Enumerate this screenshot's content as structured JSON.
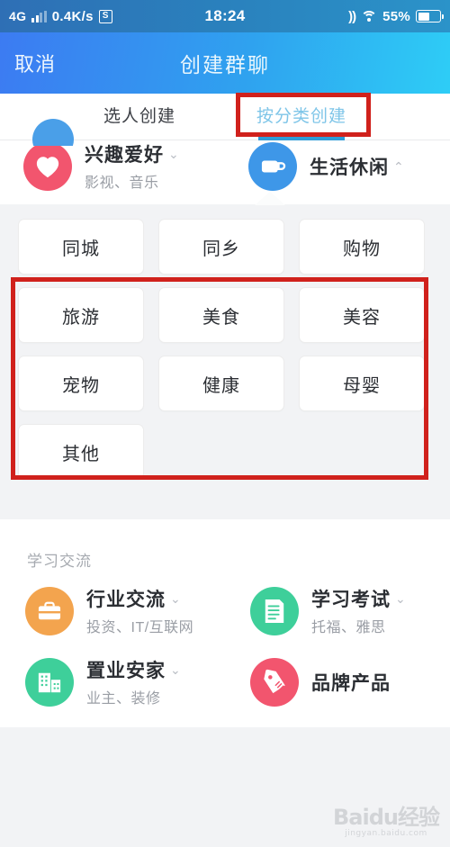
{
  "status_bar": {
    "network": "4G",
    "speed": "0.4K/s",
    "badge": "S",
    "time": "18:24",
    "vibrate_icon": "vibrate-icon",
    "wifi_icon": "wifi-icon",
    "battery_percent": "55%",
    "battery_level": 55
  },
  "nav": {
    "cancel_label": "取消",
    "title": "创建群聊"
  },
  "tabs": [
    {
      "label": "选人创建",
      "active": false
    },
    {
      "label": "按分类创建",
      "active": true
    }
  ],
  "categories": [
    {
      "title": "兴趣爱好",
      "subtitle": "影视、音乐",
      "icon": "heart-icon",
      "icon_color": "#f2556e",
      "chevron": "chevron-down-icon",
      "chevron_glyph": "⌄",
      "expanded": false
    },
    {
      "title": "生活休闲",
      "subtitle": "",
      "icon": "coffee-cup-icon",
      "icon_color": "#3e97e8",
      "chevron": "chevron-up-icon",
      "chevron_glyph": "⌃",
      "expanded": true
    }
  ],
  "grid": {
    "items": [
      "同城",
      "同乡",
      "购物",
      "旅游",
      "美食",
      "美容",
      "宠物",
      "健康",
      "母婴",
      "其他"
    ]
  },
  "section": {
    "title": "学习交流",
    "items": [
      {
        "title": "行业交流",
        "subtitle": "投资、IT/互联网",
        "icon": "briefcase-icon",
        "icon_color": "#f3a44e",
        "chevron_glyph": "⌄"
      },
      {
        "title": "学习考试",
        "subtitle": "托福、雅思",
        "icon": "document-icon",
        "icon_color": "#3ecf9a",
        "chevron_glyph": "⌄"
      },
      {
        "title": "置业安家",
        "subtitle": "业主、装修",
        "icon": "building-icon",
        "icon_color": "#3ecf9a",
        "chevron_glyph": "⌄"
      },
      {
        "title": "品牌产品",
        "subtitle": "",
        "icon": "price-tag-icon",
        "icon_color": "#f2556e",
        "chevron_glyph": ""
      }
    ]
  },
  "annotations": {
    "tab_highlight_color": "#d0211c",
    "grid_highlight_color": "#d0211c"
  },
  "watermark": {
    "main": "Baidu经验",
    "sub": "jingyan.baidu.com"
  },
  "theme": {
    "nav_gradient_start": "#3c7bf2",
    "nav_gradient_end": "#2ecdf6",
    "tab_active_color": "#7ec5e8",
    "tab_underline_color": "#2d9cd8",
    "page_bg": "#f2f3f5"
  }
}
